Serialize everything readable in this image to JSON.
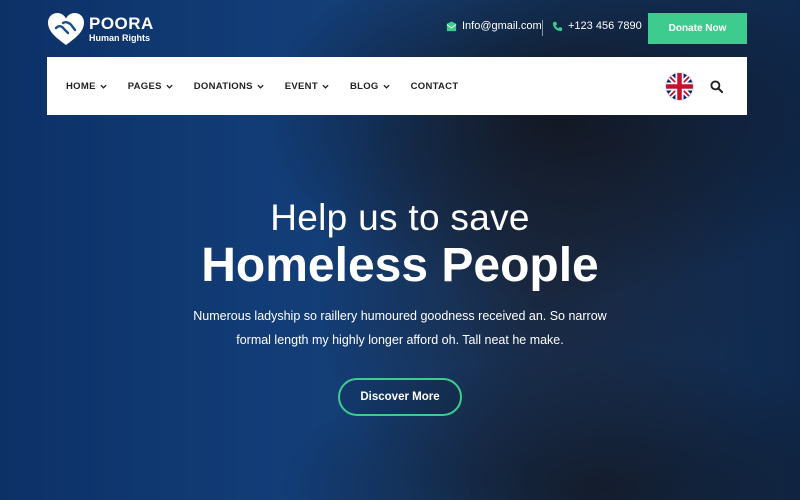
{
  "brand": {
    "name": "POORA",
    "tagline": "Human Rights"
  },
  "topbar": {
    "email": "Info@gmail.com",
    "phone": "+123 456 7890",
    "donate_label": "Donate Now"
  },
  "nav": {
    "items": [
      {
        "label": "HOME",
        "has_dropdown": true
      },
      {
        "label": "PAGES",
        "has_dropdown": true
      },
      {
        "label": "DONATIONS",
        "has_dropdown": true
      },
      {
        "label": "EVENT",
        "has_dropdown": true
      },
      {
        "label": "BLOG",
        "has_dropdown": true
      },
      {
        "label": "CONTACT",
        "has_dropdown": false
      }
    ],
    "language_icon": "uk-flag-icon",
    "search_icon": "search-icon"
  },
  "hero": {
    "subtitle": "Help us to save",
    "title": "Homeless People",
    "description_line1": "Numerous ladyship so raillery humoured goodness received an. So narrow",
    "description_line2": "formal length my highly longer afford oh. Tall neat he make.",
    "cta_label": "Discover More"
  },
  "colors": {
    "accent": "#3dcc8e",
    "nav_bg": "#ffffff",
    "text_dark": "#222222"
  }
}
